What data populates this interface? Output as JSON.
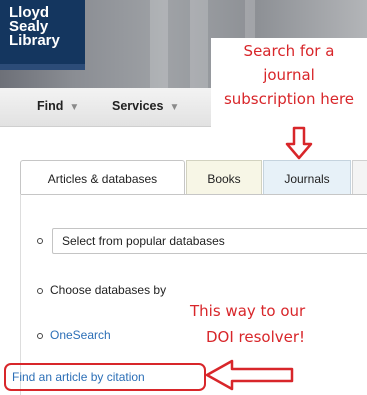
{
  "library": {
    "logo_lines": [
      "Lloyd",
      "Sealy",
      "Library"
    ]
  },
  "nav": {
    "items": [
      {
        "label": "Find"
      },
      {
        "label": "Services"
      }
    ]
  },
  "annotations": {
    "top_callout_lines": [
      "Search for a",
      "journal",
      "subscription here"
    ],
    "bottom_callout_lines": [
      "This way to our",
      "DOI resolver!"
    ],
    "color": "#d8262a"
  },
  "tabs": [
    {
      "label": "Articles & databases",
      "active": true
    },
    {
      "label": "Books",
      "active": false
    },
    {
      "label": "Journals",
      "active": false
    }
  ],
  "panel": {
    "select_value": "Select from popular databases",
    "choose_label": "Choose databases by",
    "onesearch_link": "OneSearch",
    "citation_link": "Find an article by citation"
  },
  "icons": {
    "nav_caret": "caret-down-icon",
    "down_arrow": "down-arrow-icon",
    "left_arrow": "left-arrow-icon"
  },
  "colors": {
    "logo_bg": "#14365f",
    "link": "#2c6fb7",
    "books_tab": "#f7f6e6",
    "journals_tab": "#e7f1f8"
  }
}
